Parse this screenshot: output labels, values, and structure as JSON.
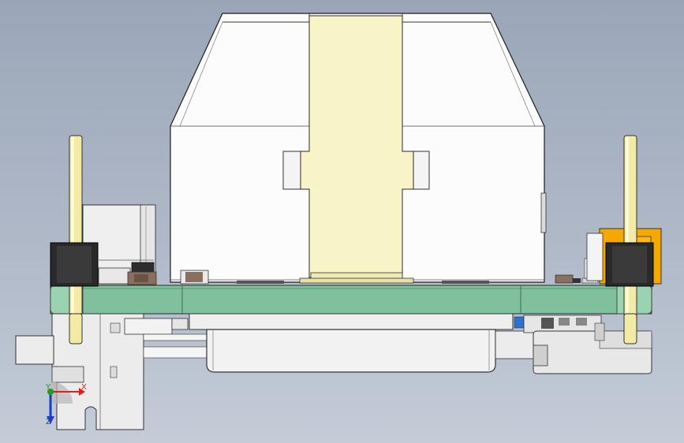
{
  "triad": {
    "x_label": "X",
    "y_label": "Y",
    "z_label": "Z"
  },
  "colors": {
    "background_top": "#9aa6b8",
    "background_bottom": "#c4ccd8",
    "pcb": "#7fbf9a",
    "enclosure": "#ffffff",
    "flex_cable": "#f7f3c6",
    "header_housing": "#2a2a2a",
    "pin": "#f3eaa8",
    "connector_orange": "#f5a800",
    "gray_part": "#ececec",
    "axis_x": "#e0201a",
    "axis_y": "#1aa01a",
    "axis_z": "#1a3cc8"
  }
}
